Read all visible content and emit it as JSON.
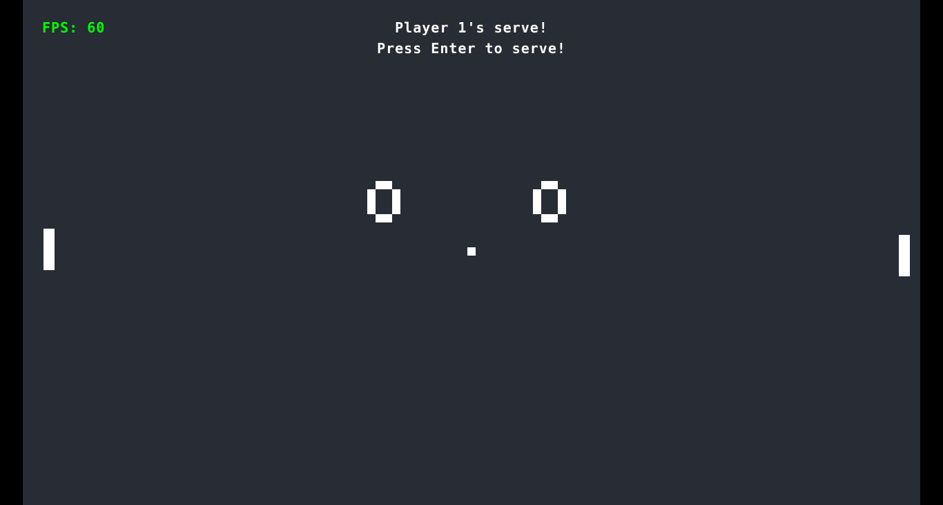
{
  "hud": {
    "fps_label": "FPS: 60",
    "fps_color": "#00ff00"
  },
  "messages": {
    "serve_status": "Player 1's serve!",
    "instruction": "Press Enter to serve!"
  },
  "scores": {
    "player1": "0",
    "player2": "0"
  },
  "colors": {
    "background": "#282c34",
    "letterbox": "#000000",
    "foreground": "#ffffff"
  }
}
